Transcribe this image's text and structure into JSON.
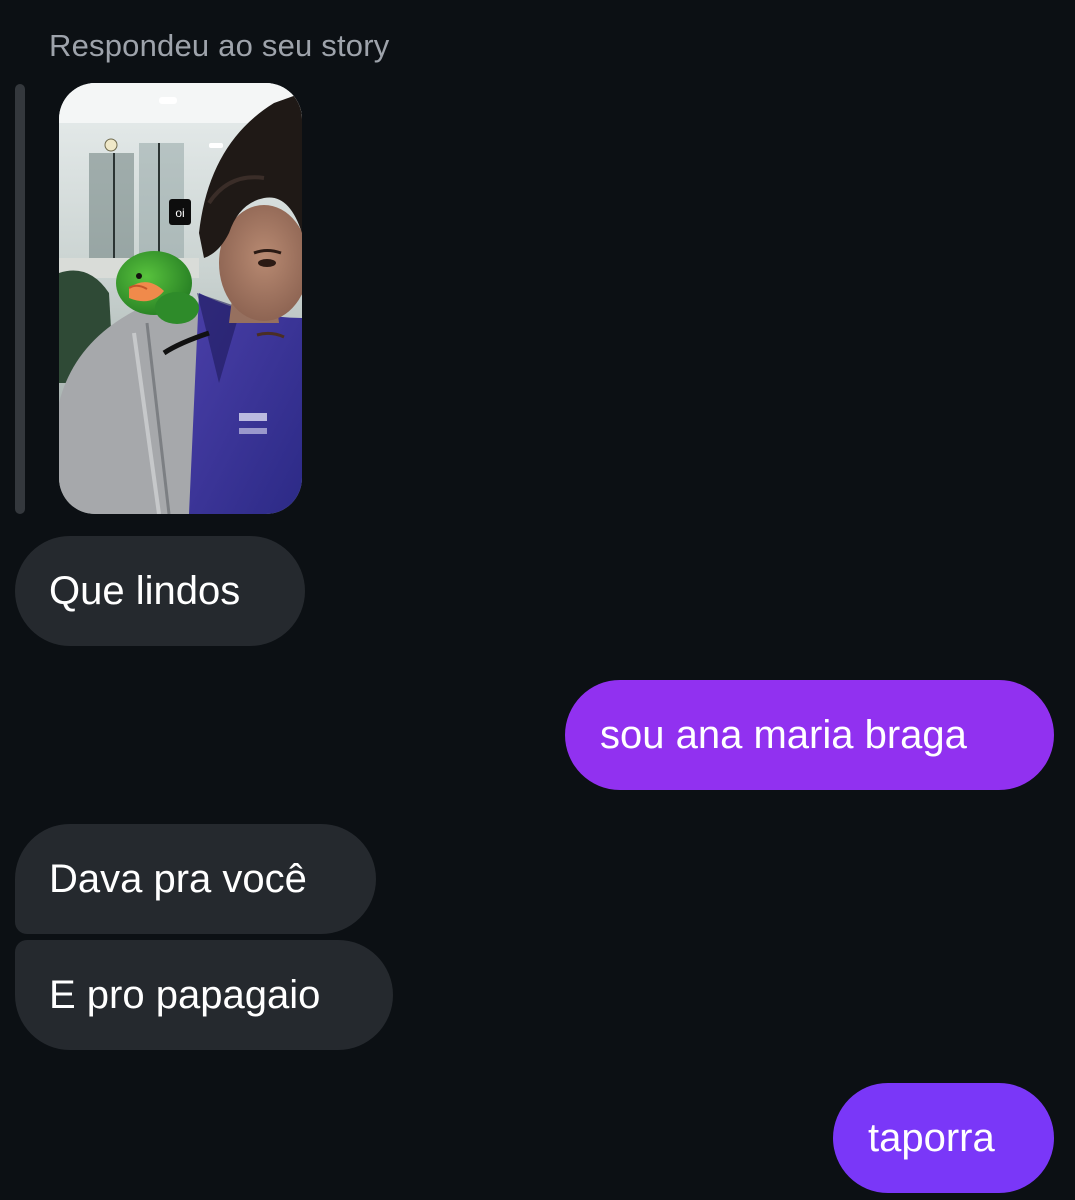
{
  "thread": {
    "reply_header": "Respondeu ao seu story",
    "story": {
      "sticker_text": "oi"
    },
    "messages": [
      {
        "sender": "them",
        "text": "Que lindos"
      },
      {
        "sender": "me",
        "text": "sou ana maria braga",
        "color": "#9131f0"
      },
      {
        "sender": "them",
        "text": "Dava pra você"
      },
      {
        "sender": "them",
        "text": "E pro papagaio"
      },
      {
        "sender": "me",
        "text": "taporra",
        "color": "#7a37f8"
      }
    ]
  },
  "theme": {
    "background": "#0c1014",
    "incoming_bubble": "#25292e",
    "outgoing_gradient_top": "#9131f0",
    "outgoing_gradient_bottom": "#7a37f8",
    "secondary_text": "#9ea3ab"
  }
}
